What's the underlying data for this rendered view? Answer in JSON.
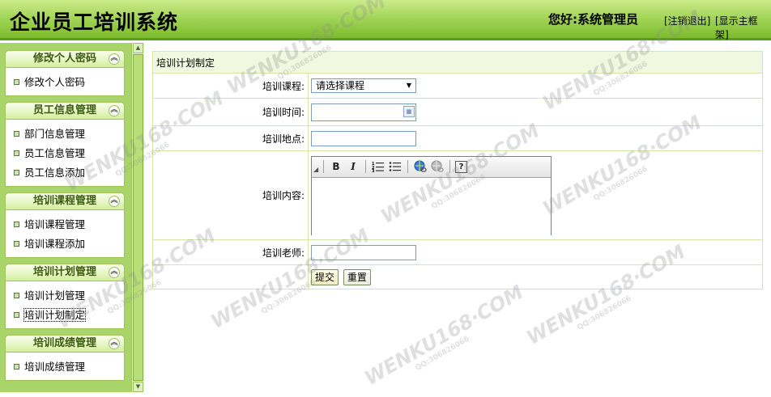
{
  "header": {
    "app_title": "企业员工培训系统",
    "greeting": "您好:系统管理员",
    "logout_link": "[注销退出]",
    "toggle_frame_link": "[显示主框架]"
  },
  "sidebar": {
    "groups": [
      {
        "title": "修改个人密码",
        "items": [
          "修改个人密码"
        ]
      },
      {
        "title": "员工信息管理",
        "items": [
          "部门信息管理",
          "员工信息管理",
          "员工信息添加"
        ]
      },
      {
        "title": "培训课程管理",
        "items": [
          "培训课程管理",
          "培训课程添加"
        ]
      },
      {
        "title": "培训计划管理",
        "items": [
          "培训计划管理",
          "培训计划制定"
        ]
      },
      {
        "title": "培训成绩管理",
        "items": [
          "培训成绩管理"
        ]
      }
    ],
    "active_item": "培训计划制定"
  },
  "form": {
    "title": "培训计划制定",
    "course_label": "培训课程:",
    "course_selected": "请选择课程",
    "time_label": "培训时间:",
    "location_label": "培训地点:",
    "content_label": "培训内容:",
    "teacher_label": "培训老师:",
    "submit_label": "提交",
    "reset_label": "重置"
  },
  "editor_toolbar": [
    "bold-icon",
    "italic-icon",
    "ordered-list-icon",
    "unordered-list-icon",
    "insert-link-icon",
    "remove-link-icon",
    "help-icon"
  ],
  "watermark": {
    "text": "WENKU168·COM",
    "sub": "QQ:306826066"
  },
  "colors": {
    "header_green": "#a4d65a",
    "sidebar_green": "#a9d46a",
    "menu_header_text": "#3b5a0d"
  }
}
